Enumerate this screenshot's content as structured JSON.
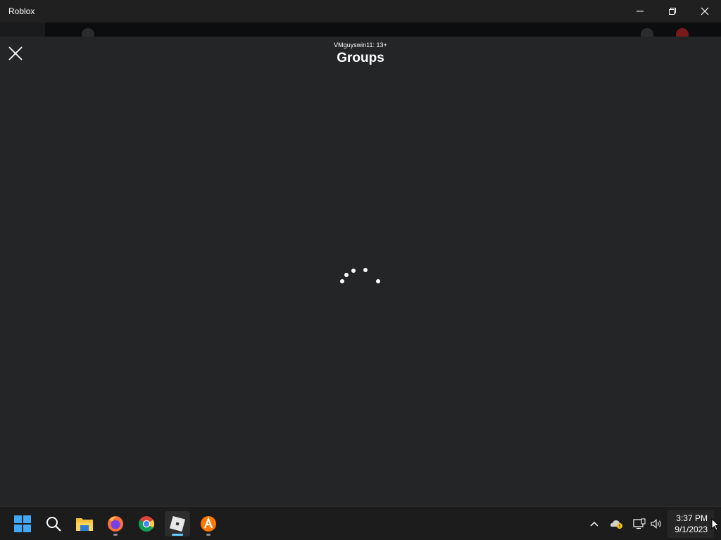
{
  "window": {
    "title": "Roblox",
    "controls": [
      "minimize",
      "restore",
      "close"
    ]
  },
  "overlay": {
    "subtitle": "VMguyswin11: 13+",
    "title": "Groups",
    "close_icon": "close-icon",
    "loading": true
  },
  "taskbar": {
    "apps": [
      {
        "name": "start",
        "icon": "windows-start-icon"
      },
      {
        "name": "search",
        "icon": "search-icon"
      },
      {
        "name": "file-explorer",
        "icon": "folder-icon"
      },
      {
        "name": "firefox",
        "icon": "firefox-icon",
        "running": true
      },
      {
        "name": "chrome",
        "icon": "chrome-icon"
      },
      {
        "name": "roblox",
        "icon": "roblox-icon",
        "running": true,
        "active": true
      },
      {
        "name": "avast",
        "icon": "avast-icon",
        "running": true
      }
    ],
    "tray": [
      "chevron-up-icon",
      "onedrive-warning-icon",
      "network-icon",
      "volume-icon"
    ],
    "clock": {
      "time": "3:37 PM",
      "date": "9/1/2023"
    }
  },
  "colors": {
    "titlebar": "#202020",
    "overlay_bg": "#232527",
    "taskbar": "#1c1c1c",
    "accent": "#60cdff"
  }
}
